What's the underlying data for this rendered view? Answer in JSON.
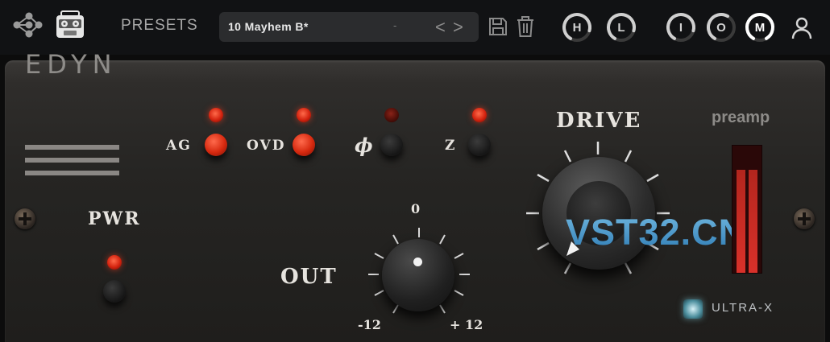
{
  "topbar": {
    "presets_label": "PRESETS",
    "preset_name": "10 Mayhem B*",
    "preset_dash": "-",
    "prev_arrow": "<",
    "next_arrow": ">",
    "mini_knobs": [
      {
        "label": "H",
        "value_fraction": 0.85
      },
      {
        "label": "L",
        "value_fraction": 0.85
      },
      {
        "label": "I",
        "value_fraction": 0.85
      },
      {
        "label": "O",
        "value_fraction": 0.6
      },
      {
        "label": "M",
        "value_fraction": 1.0
      }
    ],
    "icons": [
      "share-icon",
      "cassette-icon",
      "save-icon",
      "trash-icon",
      "user-icon"
    ]
  },
  "panel": {
    "brand": "EDYN",
    "pwr_label": "PWR",
    "switches": [
      {
        "label": "AG",
        "led": "on",
        "button": "red"
      },
      {
        "label": "OVD",
        "led": "on",
        "button": "red"
      },
      {
        "label": "ϕ",
        "led": "dim",
        "button": "dark"
      },
      {
        "label": "Z",
        "led": "on",
        "button": "dark"
      }
    ],
    "out": {
      "label": "OUT",
      "scale_top": "0",
      "scale_min": "-12",
      "scale_max": "+ 12"
    },
    "drive": {
      "label": "DRIVE"
    },
    "preamp_label": "preamp",
    "preamp_meter": {
      "left_level": 0.82,
      "right_level": 0.82
    },
    "ultrax_label": "ULTRA-X",
    "watermark": "VST32.CN"
  },
  "colors": {
    "accent_red": "#d6290f",
    "led_red": "#ff4a2a",
    "panel": "#262523",
    "topbar": "#111214"
  }
}
